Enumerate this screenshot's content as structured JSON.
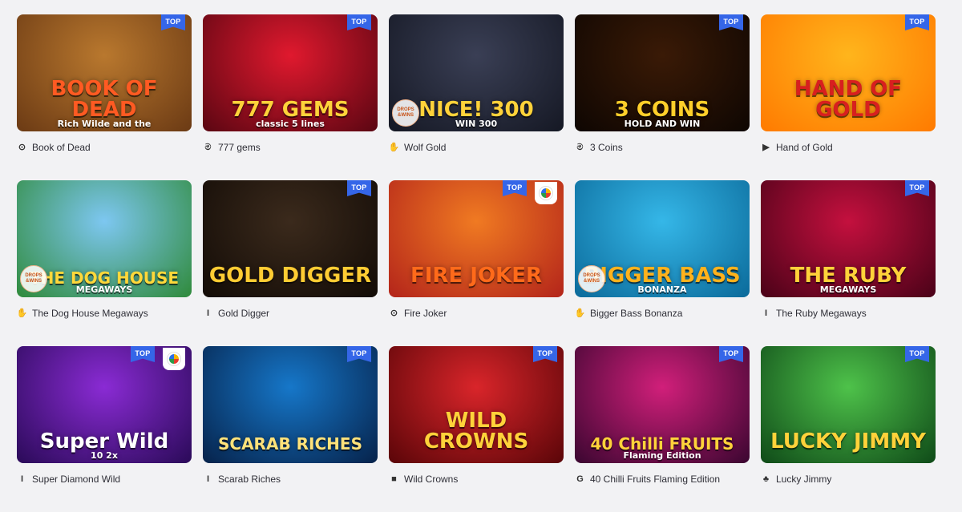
{
  "badges": {
    "top": "TOP",
    "drops_line1": "DROPS",
    "drops_line2": "&WINS"
  },
  "games": [
    {
      "name": "Book of Dead",
      "art_title": "BOOK OF DEAD",
      "art_sub": "Rich Wilde and the",
      "provider_icon": "ring-icon",
      "top": true,
      "coin": false,
      "drops": false,
      "colors": [
        "#b9782e",
        "#6b3a14"
      ],
      "title_color": "#ff5a22"
    },
    {
      "name": "777 gems",
      "art_title": "777 GEMS",
      "art_sub": "classic 5 lines",
      "provider_icon": "spiral-icon",
      "top": true,
      "coin": false,
      "drops": false,
      "colors": [
        "#e0192e",
        "#5a0612"
      ],
      "title_color": "#ffd23a"
    },
    {
      "name": "Wolf Gold",
      "art_title": "NICE! 300",
      "art_sub": "WIN 300",
      "provider_icon": "hand-icon",
      "top": false,
      "coin": false,
      "drops": true,
      "colors": [
        "#3a3f55",
        "#151824"
      ],
      "title_color": "#ffd23a"
    },
    {
      "name": "3 Coins",
      "art_title": "3 COINS",
      "art_sub": "HOLD AND WIN",
      "provider_icon": "spiral-icon",
      "top": true,
      "coin": false,
      "drops": false,
      "colors": [
        "#3a1a06",
        "#0e0602"
      ],
      "title_color": "#ffcf2a"
    },
    {
      "name": "Hand of Gold",
      "art_title": "HAND OF GOLD",
      "art_sub": "",
      "provider_icon": "play-icon",
      "top": true,
      "coin": false,
      "drops": false,
      "colors": [
        "#ffb51c",
        "#ff7a00"
      ],
      "title_color": "#d81f1f"
    },
    {
      "name": "The Dog House Megaways",
      "art_title": "THE DOG HOUSE",
      "art_sub": "MEGAWAYS",
      "provider_icon": "hand-icon",
      "top": false,
      "coin": false,
      "drops": true,
      "colors": [
        "#7dc7f1",
        "#2f8a3a"
      ],
      "title_color": "#ffd83a"
    },
    {
      "name": "Gold Digger",
      "art_title": "GOLD DIGGER",
      "art_sub": "",
      "provider_icon": "is-icon",
      "top": true,
      "coin": false,
      "drops": false,
      "colors": [
        "#3b2a1c",
        "#120b06"
      ],
      "title_color": "#ffcc33"
    },
    {
      "name": "Fire Joker",
      "art_title": "FIRE JOKER",
      "art_sub": "",
      "provider_icon": "ring-icon",
      "top": true,
      "coin": true,
      "drops": false,
      "colors": [
        "#f07a22",
        "#b3241a"
      ],
      "title_color": "#ff6a1a"
    },
    {
      "name": "Bigger Bass Bonanza",
      "art_title": "BIGGER BASS",
      "art_sub": "BONANZA",
      "provider_icon": "hand-icon",
      "top": false,
      "coin": false,
      "drops": true,
      "colors": [
        "#35b7e8",
        "#0b6a9a"
      ],
      "title_color": "#ffb21c"
    },
    {
      "name": "The Ruby Megaways",
      "art_title": "THE RUBY",
      "art_sub": "MEGAWAYS",
      "provider_icon": "is-icon",
      "top": true,
      "coin": false,
      "drops": false,
      "colors": [
        "#c4103e",
        "#4a0218"
      ],
      "title_color": "#ffd23a"
    },
    {
      "name": "Super Diamond Wild",
      "art_title": "Super Wild",
      "art_sub": "10  2x",
      "provider_icon": "is-icon",
      "top": true,
      "coin": true,
      "drops": false,
      "colors": [
        "#8a2bd4",
        "#2a0a58"
      ],
      "title_color": "#ffffff"
    },
    {
      "name": "Scarab Riches",
      "art_title": "SCARAB RICHES",
      "art_sub": "",
      "provider_icon": "is-icon",
      "top": true,
      "coin": false,
      "drops": false,
      "colors": [
        "#1677c9",
        "#06224a"
      ],
      "title_color": "#ffe27a"
    },
    {
      "name": "Wild Crowns",
      "art_title": "WILD CROWNS",
      "art_sub": "",
      "provider_icon": "square-icon",
      "top": true,
      "coin": false,
      "drops": false,
      "colors": [
        "#d9252a",
        "#5a0508"
      ],
      "title_color": "#ffd23a"
    },
    {
      "name": "40 Chilli Fruits Flaming Edition",
      "art_title": "40 Chilli FRUITS",
      "art_sub": "Flaming Edition",
      "provider_icon": "g-icon",
      "top": true,
      "coin": false,
      "drops": false,
      "colors": [
        "#d11f7a",
        "#3a0630"
      ],
      "title_color": "#ffd23a"
    },
    {
      "name": "Lucky Jimmy",
      "art_title": "LUCKY JIMMY",
      "art_sub": "",
      "provider_icon": "clover-icon",
      "top": true,
      "coin": false,
      "drops": false,
      "colors": [
        "#4ec24a",
        "#0f4a18"
      ],
      "title_color": "#ffd23a"
    }
  ]
}
